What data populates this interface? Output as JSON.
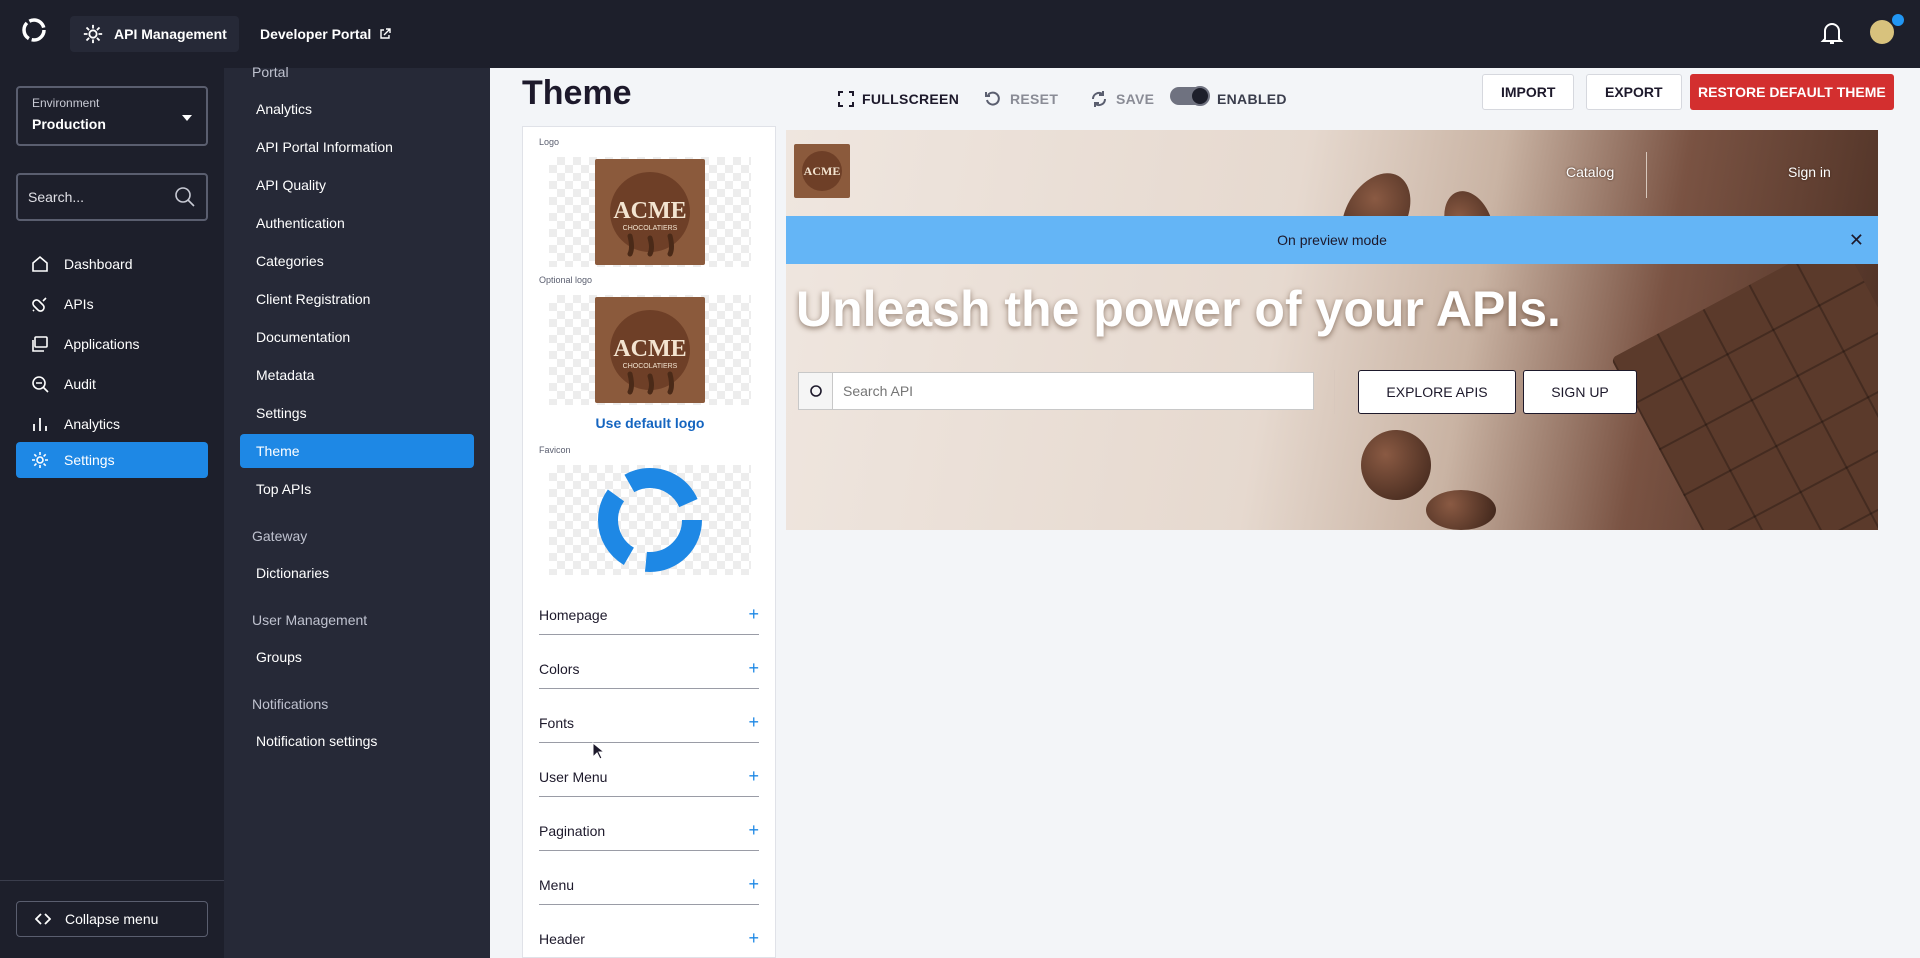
{
  "topbar": {
    "app_label": "API Management",
    "portal_link": "Developer Portal"
  },
  "leftnav": {
    "environment_label": "Environment",
    "environment_value": "Production",
    "search_placeholder": "Search...",
    "items": [
      {
        "label": "Dashboard",
        "icon": "home-icon"
      },
      {
        "label": "APIs",
        "icon": "api-icon"
      },
      {
        "label": "Applications",
        "icon": "applications-icon"
      },
      {
        "label": "Audit",
        "icon": "audit-icon"
      },
      {
        "label": "Analytics",
        "icon": "analytics-icon"
      },
      {
        "label": "Settings",
        "icon": "gear-icon",
        "active": true
      }
    ],
    "collapse_label": "Collapse menu"
  },
  "subnav": {
    "sections": [
      {
        "title": "Portal"
      },
      {
        "title": "Gateway"
      },
      {
        "title": "User Management"
      },
      {
        "title": "Notifications"
      }
    ],
    "items": [
      "Analytics",
      "API Portal Information",
      "API Quality",
      "Authentication",
      "Categories",
      "Client Registration",
      "Documentation",
      "Metadata",
      "Settings",
      "Theme",
      "Top APIs",
      "Dictionaries",
      "Groups",
      "Notification settings"
    ],
    "active_item": "Theme"
  },
  "main": {
    "title": "Theme",
    "toolbar": {
      "fullscreen": "FULLSCREEN",
      "reset": "RESET",
      "save": "SAVE",
      "enabled": "ENABLED",
      "enabled_state": true,
      "import": "IMPORT",
      "export": "EXPORT",
      "restore": "RESTORE DEFAULT THEME"
    },
    "theme_panel": {
      "logo_label": "Logo",
      "optional_logo_label": "Optional logo",
      "use_default_logo": "Use default logo",
      "favicon_label": "Favicon",
      "logo_text": "ACME",
      "logo_subtext": "CHOCOLATIERS",
      "sections": [
        "Homepage",
        "Colors",
        "Fonts",
        "User Menu",
        "Pagination",
        "Menu",
        "Header"
      ]
    },
    "preview": {
      "nav_catalog": "Catalog",
      "nav_signin": "Sign in",
      "banner": "On preview mode",
      "headline": "Unleash the power of your APIs.",
      "search_placeholder": "Search API",
      "explore_button": "EXPLORE APIS",
      "signup_button": "SIGN UP"
    }
  },
  "colors": {
    "sidebar_bg": "#1d1f2b",
    "subnav_bg": "#262937",
    "accent": "#1e88e5",
    "danger": "#d32f2f",
    "banner": "#64b5f6"
  }
}
